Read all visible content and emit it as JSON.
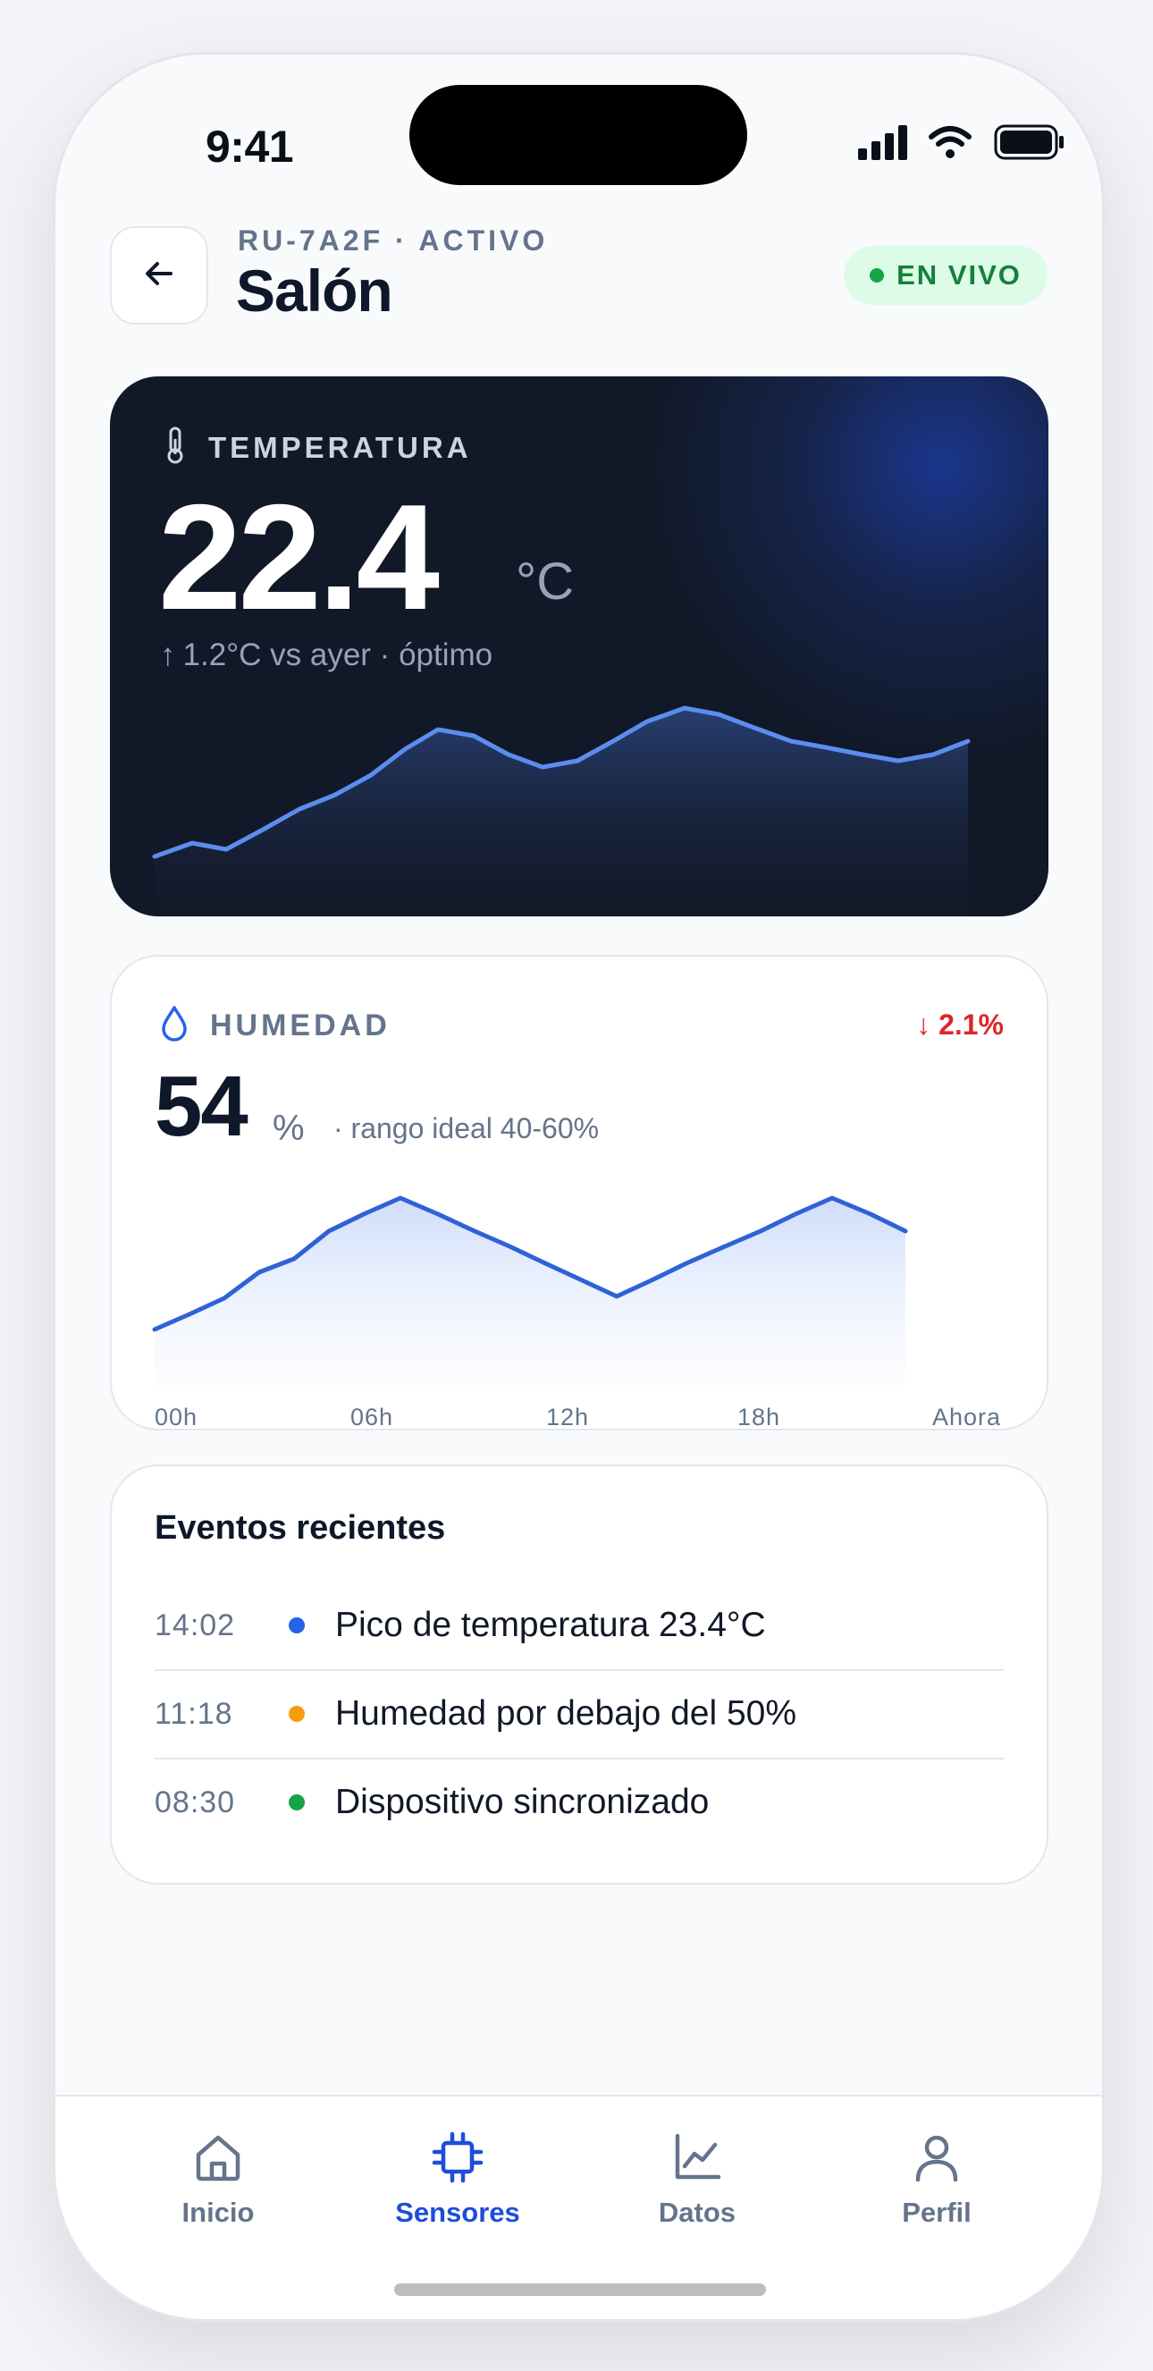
{
  "status_bar": {
    "time": "9:41",
    "icons": [
      "signal-icon",
      "wifi-icon",
      "battery-icon"
    ]
  },
  "header": {
    "back_icon": "arrow-left-icon",
    "device_id": "RU-7A2F · ACTIVO",
    "title": "Salón",
    "live_badge": "EN VIVO",
    "live_color": "#16a34a"
  },
  "temperature": {
    "icon": "thermometer-icon",
    "label": "TEMPERATURA",
    "value": "22.4",
    "unit": "°C",
    "delta_arrow": "↑",
    "delta_text": "1.2°C vs ayer · óptimo",
    "accent": "#5b8def"
  },
  "humidity": {
    "icon": "droplet-icon",
    "label": "HUMEDAD",
    "delta": "↓ 2.1%",
    "delta_color": "#dc2626",
    "value": "54",
    "unit": "%",
    "range": "· rango ideal 40-60%",
    "x_labels": [
      "00h",
      "06h",
      "12h",
      "18h",
      "Ahora"
    ],
    "accent": "#2f62d6"
  },
  "events": {
    "title": "Eventos recientes",
    "items": [
      {
        "time": "14:02",
        "text": "Pico de temperatura 23.4°C",
        "color": "#2563eb"
      },
      {
        "time": "11:18",
        "text": "Humedad por debajo del 50%",
        "color": "#f59e0b"
      },
      {
        "time": "08:30",
        "text": "Dispositivo sincronizado",
        "color": "#16a34a"
      }
    ]
  },
  "tabbar": {
    "active": "Sensores",
    "active_color": "#1d4ed8",
    "items": [
      {
        "label": "Inicio",
        "icon": "home-icon"
      },
      {
        "label": "Sensores",
        "icon": "chip-icon"
      },
      {
        "label": "Datos",
        "icon": "chart-icon"
      },
      {
        "label": "Perfil",
        "icon": "user-icon"
      }
    ]
  }
}
